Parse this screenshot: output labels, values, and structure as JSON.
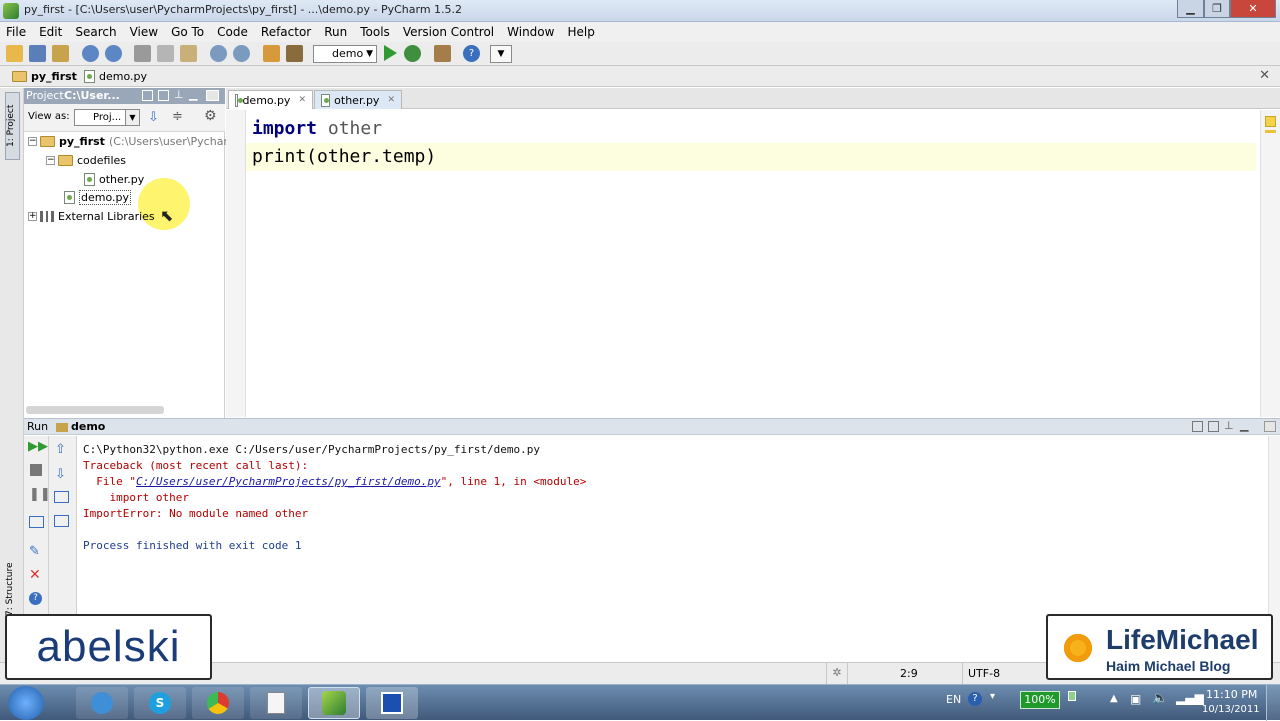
{
  "window": {
    "title": "py_first - [C:\\Users\\user\\PycharmProjects\\py_first] - ...\\demo.py - PyCharm 1.5.2"
  },
  "menu": [
    "File",
    "Edit",
    "Search",
    "View",
    "Go To",
    "Code",
    "Refactor",
    "Run",
    "Tools",
    "Version Control",
    "Window",
    "Help"
  ],
  "toolbar": {
    "run_config": "demo"
  },
  "navbar": {
    "project": "py_first",
    "file": "demo.py"
  },
  "project_panel": {
    "title": "Project",
    "path": "C:\\User...",
    "view_as_label": "View as:",
    "view_as_value": "Proj...",
    "root_name": "py_first",
    "root_path": "(C:\\Users\\user\\Pycharm",
    "folder": "codefiles",
    "file1": "other.py",
    "file2": "demo.py",
    "libraries": "External Libraries",
    "side_tab_project": "1: Project",
    "side_tab_structure": "7: Structure"
  },
  "editor": {
    "tabs": [
      "demo.py",
      "other.py"
    ],
    "code": {
      "line1_kw": "import",
      "line1_rest": " other",
      "line2": "print(other.temp)"
    }
  },
  "run_panel": {
    "label": "Run",
    "config": "demo",
    "output": {
      "cmd": "C:\\Python32\\python.exe C:/Users/user/PycharmProjects/py_first/demo.py",
      "traceback": "Traceback (most recent call last):",
      "file_prefix": "  File \"",
      "file_link": "C:/Users/user/PycharmProjects/py_first/demo.py",
      "file_suffix": "\", line 1, in <module>",
      "import_line": "    import other",
      "error": "ImportError: No module named other",
      "finished": "Process finished with exit code 1"
    }
  },
  "status": {
    "position": "2:9",
    "encoding": "UTF-8"
  },
  "taskbar": {
    "lang": "EN",
    "battery": "100%",
    "time": "11:10 PM",
    "date": "10/13/2011"
  },
  "overlay": {
    "left_logo": "abelski",
    "right_brand": "LifeMichael",
    "right_sub": "Haim Michael Blog"
  },
  "colors": {
    "error_red": "#b30000",
    "link_blue": "#1a1aa6",
    "finished_blue": "#1f3f8f",
    "keyword_navy": "#000080",
    "current_line": "#fdfde0"
  }
}
